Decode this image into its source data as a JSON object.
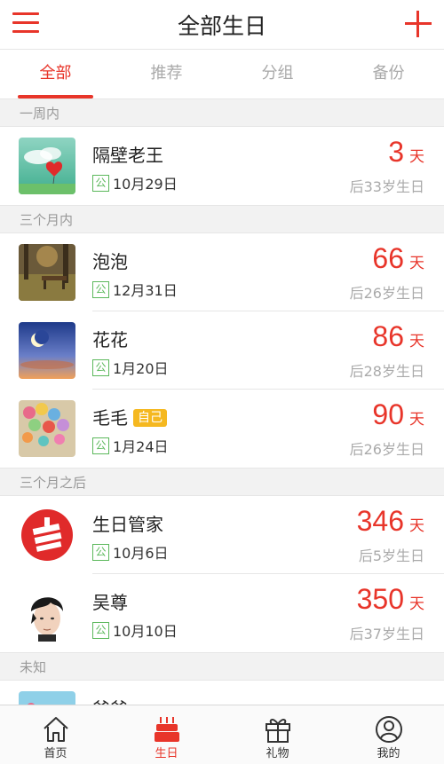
{
  "header": {
    "title": "全部生日"
  },
  "tabs": [
    {
      "label": "全部",
      "active": true
    },
    {
      "label": "推荐",
      "active": false
    },
    {
      "label": "分组",
      "active": false
    },
    {
      "label": "备份",
      "active": false
    }
  ],
  "sections": [
    {
      "title": "一周内",
      "items": [
        {
          "name": "隔壁老王",
          "badge": "",
          "calendar": "公",
          "date": "10月29日",
          "days": "3",
          "unit": "天",
          "age": "后33岁生日",
          "avatar": "red-balloon-photo"
        }
      ]
    },
    {
      "title": "三个月内",
      "items": [
        {
          "name": "泡泡",
          "badge": "",
          "calendar": "公",
          "date": "12月31日",
          "days": "66",
          "unit": "天",
          "age": "后26岁生日",
          "avatar": "park-bench-photo"
        },
        {
          "name": "花花",
          "badge": "",
          "calendar": "公",
          "date": "1月20日",
          "days": "86",
          "unit": "天",
          "age": "后28岁生日",
          "avatar": "crescent-moon-photo"
        },
        {
          "name": "毛毛",
          "badge": "自己",
          "calendar": "公",
          "date": "1月24日",
          "days": "90",
          "unit": "天",
          "age": "后26岁生日",
          "avatar": "balloons-photo"
        }
      ]
    },
    {
      "title": "三个月之后",
      "items": [
        {
          "name": "生日管家",
          "badge": "",
          "calendar": "公",
          "date": "10月6日",
          "days": "346",
          "unit": "天",
          "age": "后5岁生日",
          "avatar": "app-logo"
        },
        {
          "name": "吴尊",
          "badge": "",
          "calendar": "公",
          "date": "10月10日",
          "days": "350",
          "unit": "天",
          "age": "后37岁生日",
          "avatar": "man-portrait"
        }
      ]
    },
    {
      "title": "未知",
      "items": [
        {
          "name": "爸爸",
          "badge": "",
          "calendar": "",
          "date": "",
          "days": "",
          "unit": "",
          "age": "",
          "avatar": "cartoon-avatar"
        }
      ]
    }
  ],
  "tabbar": [
    {
      "label": "首页",
      "icon": "home-icon",
      "active": false
    },
    {
      "label": "生日",
      "icon": "cake-icon",
      "active": true
    },
    {
      "label": "礼物",
      "icon": "gift-icon",
      "active": false
    },
    {
      "label": "我的",
      "icon": "user-icon",
      "active": false
    }
  ],
  "colors": {
    "accent": "#e8352a",
    "badge": "#f5b820",
    "calendar": "#5bb85b",
    "muted": "#aaaaaa"
  }
}
